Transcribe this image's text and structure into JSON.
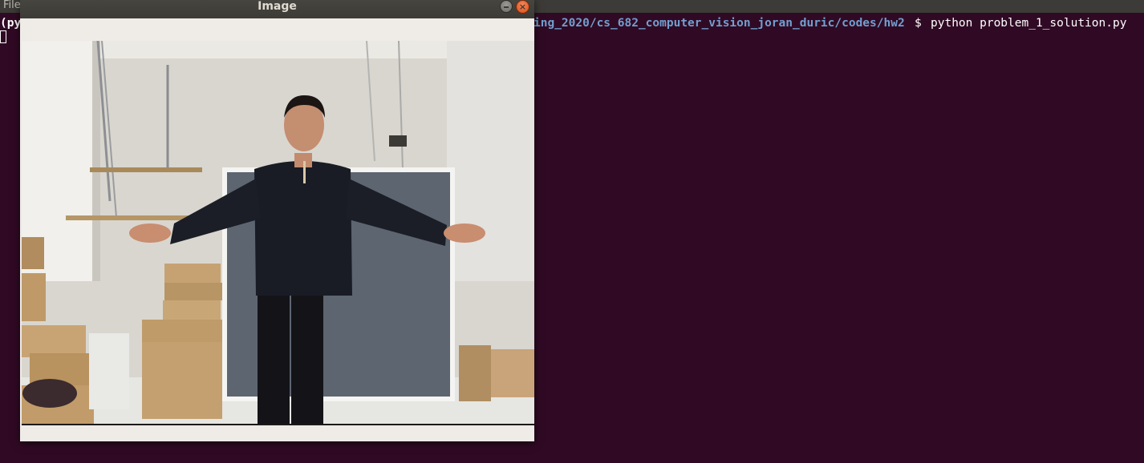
{
  "terminal": {
    "menu_file": "File",
    "prompt_prefix": "(py",
    "prompt_path": "ing_2020/cs_682_computer_vision_joran_duric/codes/hw2",
    "prompt_symbol": "$",
    "command": "python problem_1_solution.py"
  },
  "image_window": {
    "title": "Image",
    "minimize_glyph": "—",
    "close_glyph": "×",
    "photo_subject": "man-standing-arms-outstretched-in-lab"
  },
  "colors": {
    "terminal_bg": "#300a24",
    "path_blue": "#729fcf",
    "titlebar": "#3c3b37",
    "close_orange": "#e95420",
    "window_bg": "#efebe7"
  }
}
